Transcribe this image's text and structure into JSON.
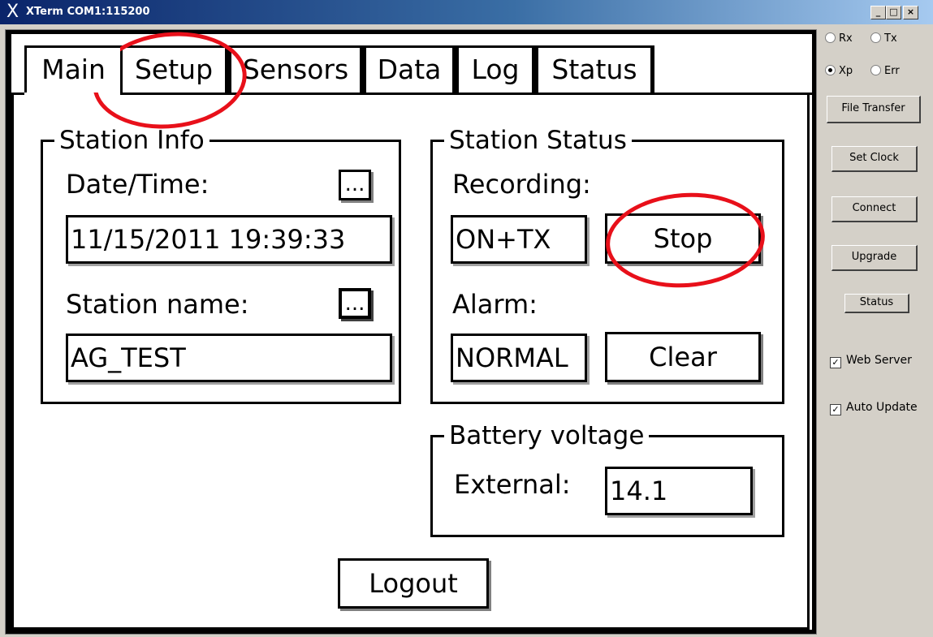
{
  "window": {
    "title": "XTerm COM1:115200",
    "icon": "X",
    "caption_buttons": {
      "minimize": "_",
      "maximize": "□",
      "close": "×"
    }
  },
  "tabs": [
    {
      "label": "Main",
      "active": true
    },
    {
      "label": "Setup",
      "active": false
    },
    {
      "label": "Sensors",
      "active": false
    },
    {
      "label": "Data",
      "active": false
    },
    {
      "label": "Log",
      "active": false
    },
    {
      "label": "Status",
      "active": false
    }
  ],
  "station_info": {
    "legend": "Station Info",
    "datetime_label": "Date/Time:",
    "datetime_btn": "...",
    "datetime_value": "11/15/2011 19:39:33",
    "name_label": "Station name:",
    "name_btn": "...",
    "name_value": "AG_TEST"
  },
  "station_status": {
    "legend": "Station Status",
    "recording_label": "Recording:",
    "recording_value": "ON+TX",
    "stop_button": "Stop",
    "alarm_label": "Alarm:",
    "alarm_value": "NORMAL",
    "clear_button": "Clear"
  },
  "battery": {
    "legend": "Battery voltage",
    "external_label": "External:",
    "external_value": "14.1"
  },
  "logout_button": "Logout",
  "side_panel": {
    "radios": [
      {
        "label": "Rx",
        "checked": false
      },
      {
        "label": "Tx",
        "checked": false
      },
      {
        "label": "Xp",
        "checked": true
      },
      {
        "label": "Err",
        "checked": false
      }
    ],
    "buttons": {
      "file_transfer": "File Transfer",
      "set_clock": "Set Clock",
      "connect": "Connect",
      "upgrade": "Upgrade",
      "status": "Status"
    },
    "checks": {
      "web_server": {
        "label": "Web Server",
        "checked": true
      },
      "auto_update": {
        "label": "Auto Update",
        "checked": true
      }
    },
    "check_glyph": "✓"
  },
  "colors": {
    "annotation": "#e8101a",
    "titlebar": "#0a246a",
    "face": "#d4d0c8"
  }
}
